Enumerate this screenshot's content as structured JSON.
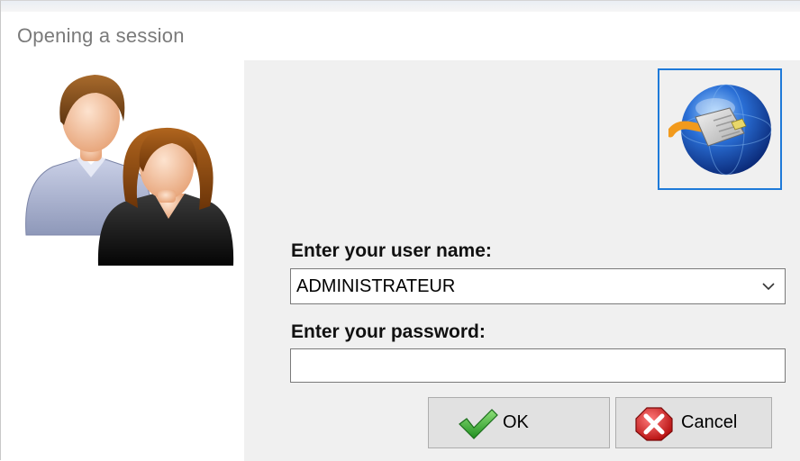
{
  "window": {
    "title": "Opening a session"
  },
  "form": {
    "username_label": "Enter your user name:",
    "username_value": "ADMINISTRATEUR",
    "password_label": "Enter your password:",
    "password_value": ""
  },
  "buttons": {
    "ok_label": "OK",
    "cancel_label": "Cancel"
  },
  "icons": {
    "users": "users-icon",
    "network": "network-globe-icon",
    "ok": "checkmark-icon",
    "cancel": "red-x-icon",
    "dropdown": "chevron-down-icon"
  },
  "colors": {
    "focus_border": "#1e7ad9",
    "panel_bg": "#f0f0f0",
    "button_bg": "#e1e1e1"
  }
}
